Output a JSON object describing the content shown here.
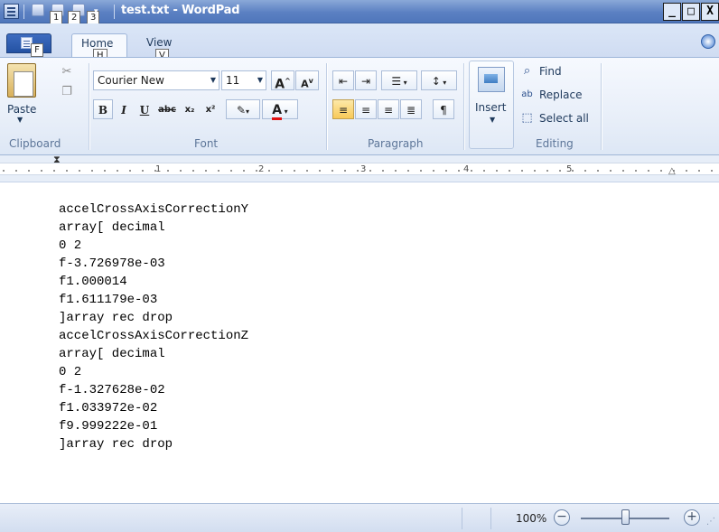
{
  "window": {
    "title": "test.txt - WordPad",
    "controls": {
      "minimize": "_",
      "maximize": "□",
      "close": "X"
    }
  },
  "qat": {
    "keytips": [
      "1",
      "2",
      "3"
    ],
    "dropdown": "▾"
  },
  "ribbon": {
    "file_keytip": "F",
    "tabs": [
      {
        "label": "Home",
        "keytip": "H"
      },
      {
        "label": "View",
        "keytip": "V"
      }
    ],
    "clipboard": {
      "paste_label": "Paste",
      "group_label": "Clipboard"
    },
    "font": {
      "family": "Courier New",
      "size": "11",
      "grow": "A",
      "shrink": "A",
      "bold": "B",
      "italic": "I",
      "underline": "U",
      "strikethrough": "abc",
      "subscript": "x₂",
      "superscript": "x²",
      "group_label": "Font"
    },
    "paragraph": {
      "group_label": "Paragraph"
    },
    "insert": {
      "label": "Insert"
    },
    "editing": {
      "find": "Find",
      "replace": "Replace",
      "select_all": "Select all",
      "group_label": "Editing"
    }
  },
  "ruler": {
    "numbers": [
      "1",
      "2",
      "3",
      "4",
      "5"
    ]
  },
  "document": {
    "lines": [
      "accelCrossAxisCorrectionY",
      "array[ decimal",
      "0 2",
      "f-3.726978e-03",
      "f1.000014",
      "f1.611179e-03",
      "]array rec drop",
      "accelCrossAxisCorrectionZ",
      "array[ decimal",
      "0 2",
      "f-1.327628e-02",
      "f1.033972e-02",
      "f9.999222e-01",
      "]array rec drop"
    ]
  },
  "statusbar": {
    "zoom": "100%",
    "zoom_out": "−",
    "zoom_in": "+",
    "zoom_level_fraction": 0.5
  }
}
